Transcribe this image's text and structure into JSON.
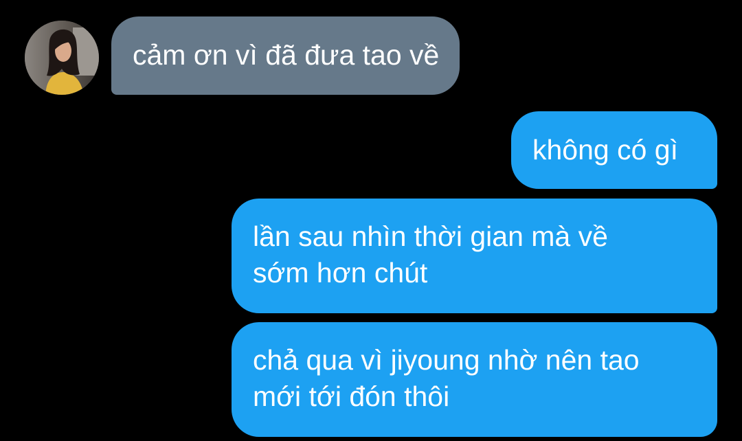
{
  "conversation": {
    "contact": {
      "avatar_icon": "profile-photo"
    },
    "messages": [
      {
        "direction": "incoming",
        "lines": [
          "cảm ơn vì đã đưa tao về"
        ]
      },
      {
        "direction": "outgoing",
        "lines": [
          "không có gì"
        ]
      },
      {
        "direction": "outgoing",
        "lines": [
          "lần sau nhìn thời gian mà về",
          "sớm hơn chút"
        ]
      },
      {
        "direction": "outgoing",
        "lines": [
          "chả qua vì jiyoung nhờ nên tao",
          "mới tới đón thôi"
        ]
      }
    ]
  },
  "colors": {
    "background": "#000000",
    "incoming_bubble": "#66798a",
    "outgoing_bubble": "#1da1f2",
    "text": "#ffffff"
  }
}
